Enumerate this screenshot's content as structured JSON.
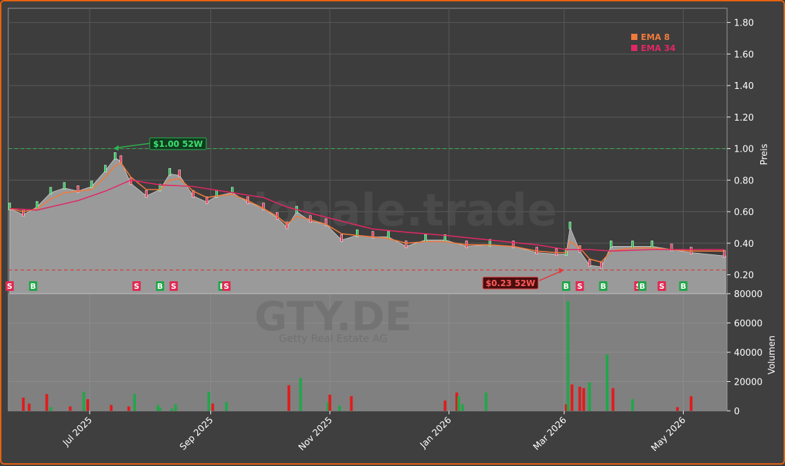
{
  "watermark": {
    "brand": "forexsignale.trade",
    "ticker": "GTY.DE",
    "company": "Getty Real Estate AG"
  },
  "legend": [
    {
      "label": "EMA 8",
      "color": "#f07a3c"
    },
    {
      "label": "EMA 34",
      "color": "#e02864"
    }
  ],
  "annotations": {
    "high_label": "$1.00 52W",
    "high_value": 1.0,
    "low_label": "$0.23 52W",
    "low_value": 0.23
  },
  "colors": {
    "up": "#22a64a",
    "down": "#e01c1c",
    "buy_badge": "#22a64a",
    "sell_badge": "#e02a52",
    "area": "#9a9a9a"
  },
  "signals": [
    {
      "label": "S",
      "x": "2025-05-21"
    },
    {
      "label": "B",
      "x": "2025-06-02"
    },
    {
      "label": "S",
      "x": "2025-07-25"
    },
    {
      "label": "B",
      "x": "2025-08-06"
    },
    {
      "label": "S",
      "x": "2025-08-13"
    },
    {
      "label": "B",
      "x": "2025-09-07"
    },
    {
      "label": "S",
      "x": "2025-09-09"
    },
    {
      "label": "B",
      "x": "2026-03-02"
    },
    {
      "label": "S",
      "x": "2026-03-09"
    },
    {
      "label": "B",
      "x": "2026-03-21"
    },
    {
      "label": "S",
      "x": "2026-04-08"
    },
    {
      "label": "B",
      "x": "2026-04-10"
    },
    {
      "label": "S",
      "x": "2026-04-20"
    },
    {
      "label": "B",
      "x": "2026-05-01"
    }
  ],
  "chart_data": {
    "type": "line",
    "x_axis": {
      "ticks": [
        "Jul 2025",
        "Sep 2025",
        "Nov 2025",
        "Jan 2026",
        "Mar 2026",
        "May 2026"
      ],
      "tick_dates": [
        "2025-07-01",
        "2025-09-01",
        "2025-11-01",
        "2026-01-01",
        "2026-03-01",
        "2026-05-01"
      ],
      "range": [
        "2025-05-21",
        "2026-05-22"
      ]
    },
    "price_panel": {
      "ylabel": "Preis",
      "ylim": [
        0.08,
        1.89
      ],
      "yticks": [
        0.2,
        0.4,
        0.6,
        0.8,
        1.0,
        1.2,
        1.4,
        1.6,
        1.8
      ],
      "reference_lines": [
        {
          "label": "$1.00 52W",
          "value": 1.0,
          "style": "dashed",
          "color": "#2fb24f"
        },
        {
          "label": "$0.23 52W",
          "value": 0.23,
          "style": "dashed",
          "color": "#d83030"
        }
      ],
      "series": [
        {
          "name": "",
          "kind": "area",
          "x": [
            "2025-05-21",
            "2025-05-28",
            "2025-06-04",
            "2025-06-11",
            "2025-06-18",
            "2025-06-25",
            "2025-07-02",
            "2025-07-09",
            "2025-07-14",
            "2025-07-17",
            "2025-07-22",
            "2025-07-30",
            "2025-08-06",
            "2025-08-11",
            "2025-08-16",
            "2025-08-23",
            "2025-08-30",
            "2025-09-04",
            "2025-09-12",
            "2025-09-20",
            "2025-09-28",
            "2025-10-05",
            "2025-10-10",
            "2025-10-15",
            "2025-10-22",
            "2025-10-30",
            "2025-11-07",
            "2025-11-15",
            "2025-11-23",
            "2025-12-01",
            "2025-12-10",
            "2025-12-20",
            "2025-12-30",
            "2026-01-10",
            "2026-01-22",
            "2026-02-03",
            "2026-02-15",
            "2026-02-25",
            "2026-03-02",
            "2026-03-04",
            "2026-03-09",
            "2026-03-14",
            "2026-03-20",
            "2026-03-25",
            "2026-04-05",
            "2026-04-15",
            "2026-04-25",
            "2026-05-05",
            "2026-05-22"
          ],
          "y": [
            0.62,
            0.58,
            0.63,
            0.72,
            0.75,
            0.73,
            0.76,
            0.86,
            0.94,
            0.92,
            0.78,
            0.7,
            0.74,
            0.84,
            0.83,
            0.7,
            0.66,
            0.7,
            0.72,
            0.66,
            0.62,
            0.56,
            0.5,
            0.6,
            0.54,
            0.52,
            0.42,
            0.45,
            0.44,
            0.44,
            0.38,
            0.42,
            0.42,
            0.38,
            0.39,
            0.38,
            0.34,
            0.33,
            0.33,
            0.5,
            0.35,
            0.26,
            0.25,
            0.38,
            0.38,
            0.38,
            0.36,
            0.34,
            0.32
          ]
        },
        {
          "name": "EMA 8",
          "kind": "line",
          "x": [
            "2025-05-21",
            "2025-05-28",
            "2025-06-04",
            "2025-06-11",
            "2025-06-18",
            "2025-06-25",
            "2025-07-02",
            "2025-07-09",
            "2025-07-14",
            "2025-07-17",
            "2025-07-22",
            "2025-07-30",
            "2025-08-06",
            "2025-08-11",
            "2025-08-16",
            "2025-08-23",
            "2025-08-30",
            "2025-09-04",
            "2025-09-12",
            "2025-09-20",
            "2025-09-28",
            "2025-10-05",
            "2025-10-10",
            "2025-10-15",
            "2025-10-22",
            "2025-10-30",
            "2025-11-07",
            "2025-11-15",
            "2025-11-23",
            "2025-12-01",
            "2025-12-10",
            "2025-12-20",
            "2025-12-30",
            "2026-01-10",
            "2026-01-22",
            "2026-02-03",
            "2026-02-15",
            "2026-02-25",
            "2026-03-02",
            "2026-03-04",
            "2026-03-09",
            "2026-03-14",
            "2026-03-20",
            "2026-03-25",
            "2026-04-05",
            "2026-04-15",
            "2026-04-25",
            "2026-05-05",
            "2026-05-22"
          ],
          "y": [
            0.62,
            0.6,
            0.62,
            0.68,
            0.72,
            0.73,
            0.74,
            0.82,
            0.89,
            0.91,
            0.82,
            0.74,
            0.74,
            0.8,
            0.81,
            0.73,
            0.69,
            0.7,
            0.71,
            0.67,
            0.62,
            0.57,
            0.52,
            0.57,
            0.55,
            0.52,
            0.46,
            0.45,
            0.44,
            0.43,
            0.4,
            0.41,
            0.41,
            0.39,
            0.39,
            0.38,
            0.35,
            0.34,
            0.34,
            0.41,
            0.37,
            0.3,
            0.28,
            0.35,
            0.37,
            0.37,
            0.36,
            0.35,
            0.35
          ]
        },
        {
          "name": "EMA 34",
          "kind": "line",
          "x": [
            "2025-05-21",
            "2025-06-04",
            "2025-06-25",
            "2025-07-09",
            "2025-07-22",
            "2025-08-06",
            "2025-08-23",
            "2025-09-12",
            "2025-09-28",
            "2025-10-10",
            "2025-10-22",
            "2025-11-07",
            "2025-11-23",
            "2025-12-10",
            "2025-12-30",
            "2026-01-22",
            "2026-02-15",
            "2026-03-02",
            "2026-03-14",
            "2026-03-25",
            "2026-04-15",
            "2026-05-05",
            "2026-05-22"
          ],
          "y": [
            0.62,
            0.61,
            0.67,
            0.73,
            0.8,
            0.77,
            0.76,
            0.72,
            0.69,
            0.63,
            0.59,
            0.54,
            0.49,
            0.47,
            0.45,
            0.42,
            0.39,
            0.36,
            0.36,
            0.35,
            0.36,
            0.36,
            0.36
          ]
        }
      ]
    },
    "volume_panel": {
      "ylabel": "Volumen",
      "ylim": [
        0,
        80000
      ],
      "yticks": [
        0,
        20000,
        40000,
        60000,
        80000
      ],
      "series": [
        {
          "name": "",
          "kind": "bar",
          "x": [
            "2025-05-28",
            "2025-05-31",
            "2025-06-09",
            "2025-06-11",
            "2025-06-21",
            "2025-06-28",
            "2025-06-30",
            "2025-07-12",
            "2025-07-21",
            "2025-07-24",
            "2025-08-05",
            "2025-08-06",
            "2025-08-12",
            "2025-08-14",
            "2025-08-31",
            "2025-09-02",
            "2025-09-09",
            "2025-10-11",
            "2025-10-17",
            "2025-10-31",
            "2025-11-01",
            "2025-11-06",
            "2025-11-12",
            "2025-12-30",
            "2026-01-05",
            "2026-01-06",
            "2026-01-08",
            "2026-01-20",
            "2026-03-02",
            "2026-03-03",
            "2026-03-05",
            "2026-03-09",
            "2026-03-11",
            "2026-03-14",
            "2026-03-23",
            "2026-03-26",
            "2026-04-28",
            "2026-05-05",
            "2026-04-05"
          ],
          "y": [
            9000,
            5000,
            11500,
            2500,
            3000,
            13000,
            8000,
            4000,
            3000,
            11500,
            4000,
            2000,
            1500,
            4500,
            13000,
            5000,
            6000,
            17500,
            22500,
            6000,
            11000,
            3500,
            10000,
            7000,
            12500,
            10000,
            4500,
            12500,
            4500,
            75000,
            18000,
            16500,
            15500,
            19500,
            38500,
            15500,
            2500,
            10000,
            8000
          ],
          "colors": [
            "down",
            "down",
            "down",
            "up",
            "down",
            "up",
            "down",
            "down",
            "down",
            "up",
            "up",
            "up",
            "up",
            "up",
            "up",
            "down",
            "up",
            "down",
            "up",
            "up",
            "down",
            "up",
            "down",
            "down",
            "down",
            "up",
            "up",
            "up",
            "down",
            "up",
            "down",
            "down",
            "down",
            "up",
            "up",
            "down",
            "down",
            "down",
            "up"
          ]
        }
      ]
    }
  }
}
